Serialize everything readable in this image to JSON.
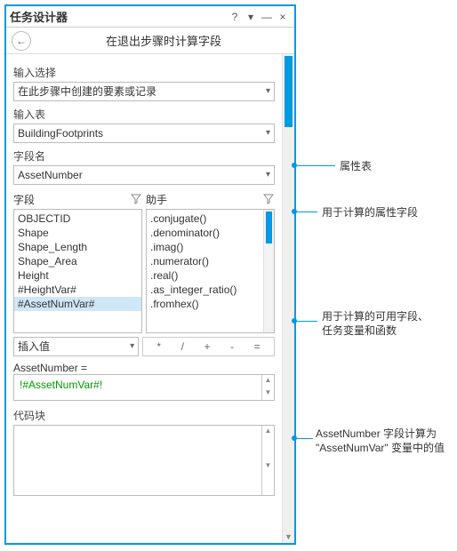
{
  "titlebar": {
    "title": "任务设计器",
    "help": "?",
    "dock": "▾",
    "minimize": "—",
    "close": "×"
  },
  "subheader": {
    "back": "←",
    "title": "在退出步骤时计算字段"
  },
  "labels": {
    "input_select": "输入选择",
    "input_table": "输入表",
    "field_name": "字段名",
    "fields": "字段",
    "helpers": "助手",
    "insert_value": "插入值",
    "code_block": "代码块"
  },
  "values": {
    "input_select": "在此步骤中创建的要素或记录",
    "input_table": "BuildingFootprints",
    "field_name": "AssetNumber",
    "expr_label": "AssetNumber =",
    "expression": "!#AssetNumVar#!"
  },
  "fields_list": [
    "OBJECTID",
    "Shape",
    "Shape_Length",
    "Shape_Area",
    "Height",
    "#HeightVar#",
    "#AssetNumVar#"
  ],
  "fields_selected": "#AssetNumVar#",
  "helpers_list": [
    ".conjugate()",
    ".denominator()",
    ".imag()",
    ".numerator()",
    ".real()",
    ".as_integer_ratio()",
    ".fromhex()"
  ],
  "ops": [
    "*",
    "/",
    "+",
    "-",
    "="
  ],
  "callouts": {
    "c1": "属性表",
    "c2": "用于计算的属性字段",
    "c3a": "用于计算的可用字段、",
    "c3b": "任务变量和函数",
    "c4a": "AssetNumber 字段计算为",
    "c4b": "\"AssetNumVar\" 变量中的值"
  }
}
